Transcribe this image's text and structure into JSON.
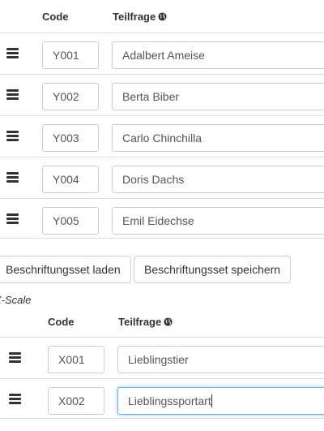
{
  "table_y": {
    "header": {
      "code": "Code",
      "subquestion": "Teilfrage"
    },
    "rows": [
      {
        "code": "Y001",
        "text": "Adalbert Ameise"
      },
      {
        "code": "Y002",
        "text": "Berta Biber"
      },
      {
        "code": "Y003",
        "text": "Carlo Chinchilla"
      },
      {
        "code": "Y004",
        "text": "Doris Dachs"
      },
      {
        "code": "Y005",
        "text": "Emil Eidechse"
      }
    ]
  },
  "buttons": {
    "load_labelset": "Beschriftungsset laden",
    "save_labelset": "Beschriftungsset speichern"
  },
  "x_scale": {
    "label": "X-Scale",
    "header": {
      "code": "Code",
      "subquestion": "Teilfrage"
    },
    "rows": [
      {
        "code": "X001",
        "text": "Lieblingstier"
      },
      {
        "code": "X002",
        "text": "Lieblingssportart"
      }
    ]
  },
  "icons": {
    "drag_handle": "bars-icon",
    "language": "globe-icon"
  },
  "colors": {
    "focus_border": "#66afe9",
    "input_border": "#cccccc",
    "row_divider": "#dddddd"
  }
}
